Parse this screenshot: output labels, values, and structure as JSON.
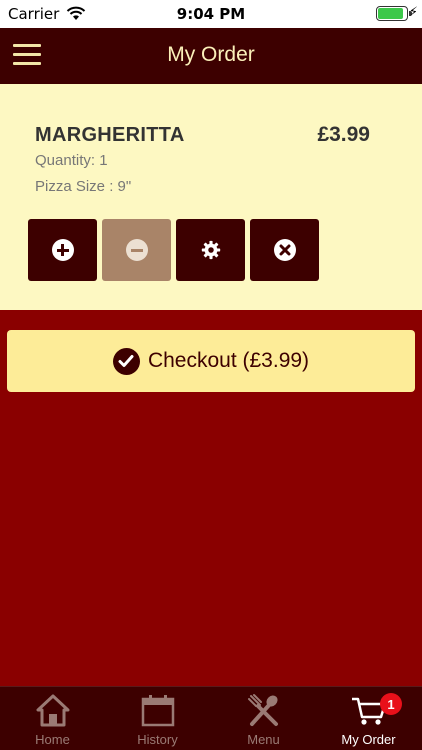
{
  "status_bar": {
    "carrier": "Carrier",
    "time": "9:04 PM",
    "battery_level": 0.9
  },
  "header": {
    "title": "My Order"
  },
  "order": {
    "items": [
      {
        "name": "MARGHERITTA",
        "price": "£3.99",
        "quantity_text": "Quantity: 1",
        "size_text": "Pizza Size : 9\""
      }
    ],
    "actions": [
      {
        "icon": "plus-circle-icon",
        "enabled": true
      },
      {
        "icon": "minus-circle-icon",
        "enabled": false
      },
      {
        "icon": "gear-icon",
        "enabled": true
      },
      {
        "icon": "close-circle-icon",
        "enabled": true
      }
    ]
  },
  "checkout": {
    "label": "Checkout (£3.99)"
  },
  "tab_bar": {
    "tabs": [
      {
        "label": "Home",
        "icon": "home-icon"
      },
      {
        "label": "History",
        "icon": "calendar-icon"
      },
      {
        "label": "Menu",
        "icon": "utensils-icon"
      },
      {
        "label": "My Order",
        "icon": "cart-icon",
        "badge": "1",
        "active": true
      }
    ]
  },
  "colors": {
    "background": "#8a0000",
    "bar": "#3d0000",
    "item_bg": "#fdf8c2",
    "checkout_bg": "#fdec98",
    "badge": "#e8101a"
  }
}
